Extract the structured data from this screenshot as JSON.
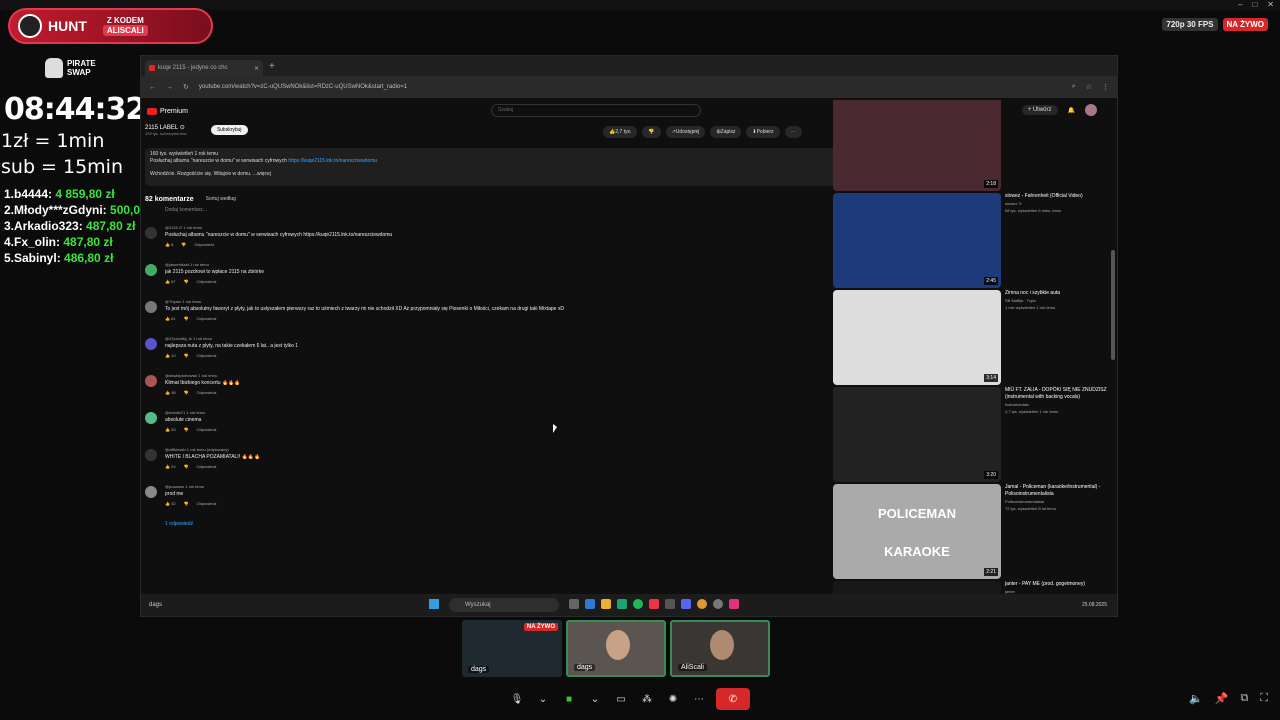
{
  "overlay": {
    "hunt": {
      "brand": "HUNT",
      "code_label": "Z KODEM",
      "code": "ALISCALI"
    },
    "pirate": {
      "line1": "PIRATE",
      "line2": "SWAP"
    },
    "clock": "08:44:32",
    "rate1": "1zł = 1min",
    "rate2": "sub = 15min",
    "leaderboard": [
      {
        "name": "1.b4444: ",
        "amount": "4 859,80 zł"
      },
      {
        "name": "2.Młody***zGdyni: ",
        "amount": "500,00 zł"
      },
      {
        "name": "3.Arkadio323: ",
        "amount": "487,80 zł"
      },
      {
        "name": "4.Fx_olin: ",
        "amount": "487,80 zł"
      },
      {
        "name": "5.Sabinyl: ",
        "amount": "486,80 zł"
      }
    ]
  },
  "stream": {
    "quality": "720p 30 FPS",
    "live": "NA ŻYWO"
  },
  "browser": {
    "tab_title": "kuqe 2115 - jedyne co chc",
    "url": "youtube.com/watch?v=zC-uQUSwNOk&list=RDzC-uQUSwNOk&start_radio=1",
    "yt": {
      "premium": "Premium",
      "search_placeholder": "Szukaj",
      "create": "Utwórz",
      "channel": "2115 LABEL ⊙",
      "subs": "199 tys. subskrybentów",
      "subscribe": "Subskrybuj",
      "actions": {
        "likes": "2,7 tys.",
        "share": "Udostępnij",
        "save": "Zapisz",
        "download": "Pobierz"
      },
      "desc_line1": "160 tys. wyświetleń  1 rok temu",
      "desc_line2": "Posłuchaj albumu \"nareszcie w domu\" w serwisach cyfrowych ",
      "desc_link": "https://kuqe2115.lnk.to/nareszciewdomu",
      "desc_line3": "Wchodźcie. Rozgośćcie się. Witajcie w domu.   ...więcej",
      "comments_count": "82 komentarze",
      "sort": "Sortuj według",
      "add_comment": "Dodaj komentarz..."
    }
  },
  "comments": [
    {
      "author": "@2115 ⊙  1 rok temu",
      "text": "Posłuchaj albumu \"nareszcie w domu\" w serwisach cyfrowych https://kuqe2115.lnk.to/nareszciewdomu",
      "likes": "8",
      "reply": "Odpowiedz",
      "color": "#333"
    },
    {
      "author": "@jasnehlkskt  1 rok temu",
      "text": "jak 2115 pozdrowi to wpłace 2115 na zbiórke",
      "likes": "67",
      "reply": "Odpowiedz",
      "color": "#4a6"
    },
    {
      "author": "@Thyrax  1 rok temu",
      "text": "To jest mój absolutny faworyt z płyty, jak to usłyszałem pierwszy raz to uśmiech z twarzy mi nie schodził XD  Aż przypomniały się Piosenki o Miłości, czekam na drugi taki Mixtape xD",
      "likes": "81",
      "reply": "Odpowiedz",
      "color": "#777"
    },
    {
      "author": "@47proofity_tc  1 rok temu",
      "text": "najlepsza nuta z płyty, na takie czekałem 6 lat.. a jest tylko 1",
      "likes": "10",
      "reply": "Odpowiedz",
      "color": "#55c"
    },
    {
      "author": "@dawidpiotrowski  1 rok temu",
      "text": "Klimat Ibizkiego koncertu 🔥🔥🔥",
      "likes": "38",
      "reply": "Odpowiedz",
      "color": "#a55"
    },
    {
      "author": "@mantis71  1 rok temu",
      "text": "absolute cinema",
      "likes": "33",
      "reply": "Odpowiedz",
      "color": "#5b8"
    },
    {
      "author": "@ziffkinsah  1 rok temu (edytowany)",
      "text": "WHITE I BLACHA POZAMIATALI! 🔥🔥🔥",
      "likes": "24",
      "reply": "Odpowiedz",
      "color": "#333"
    },
    {
      "author": "@pusanos  1 rok temu",
      "text": "prod me",
      "likes": "32",
      "reply": "Odpowiedz",
      "color": "#888"
    }
  ],
  "replies_toggle": "1 odpowiedź",
  "recs": [
    {
      "title": "",
      "channel": "",
      "meta": "",
      "duration": "2:18"
    },
    {
      "title": "slowez - Fahrenheit (Official Video)",
      "channel": "slowez ⊙",
      "meta": "58 tys. wyświetleń  5 mies. temu",
      "duration": "2:45"
    },
    {
      "title": "Zimna noc i szybkie auta",
      "channel": "SB Maffija · Topic",
      "meta": "1 mln wyświetleń  1 rok temu",
      "duration": "3:14"
    },
    {
      "title": "MIÜ FT. ZALIA - DOPÓKI SIĘ NIE ZNUDZISZ (instrumental with backing vocals)",
      "channel": "Instrumentals",
      "meta": "2,7 tys. wyświetleń  1 rok temu",
      "duration": "3:20"
    },
    {
      "title": "Jamal - Policeman (karaoke/instrumental) - Polisoinstrumentalista",
      "channel": "Polisoinstrumentalista",
      "meta": "72 tys. wyświetleń  8 lat temu",
      "duration": "2:21",
      "overlay1": "POLICEMAN",
      "overlay2": "KARAOKE"
    },
    {
      "title": "janter - PAY ME (prod. gogetmoney)",
      "channel": "janter",
      "meta": "673 tys.  1 mies. temu",
      "duration": ""
    }
  ],
  "taskbar": {
    "user": "dags",
    "search": "Wyszukaj",
    "date": "25.08.2025"
  },
  "tiles": [
    {
      "name": "dags",
      "live": "NA ŻYWO"
    },
    {
      "name": "dags"
    },
    {
      "name": "AliScali"
    }
  ],
  "colors": {
    "accent_live": "#d62828",
    "hunt_red": "#c21b2e",
    "money_green": "#3ce33c"
  }
}
